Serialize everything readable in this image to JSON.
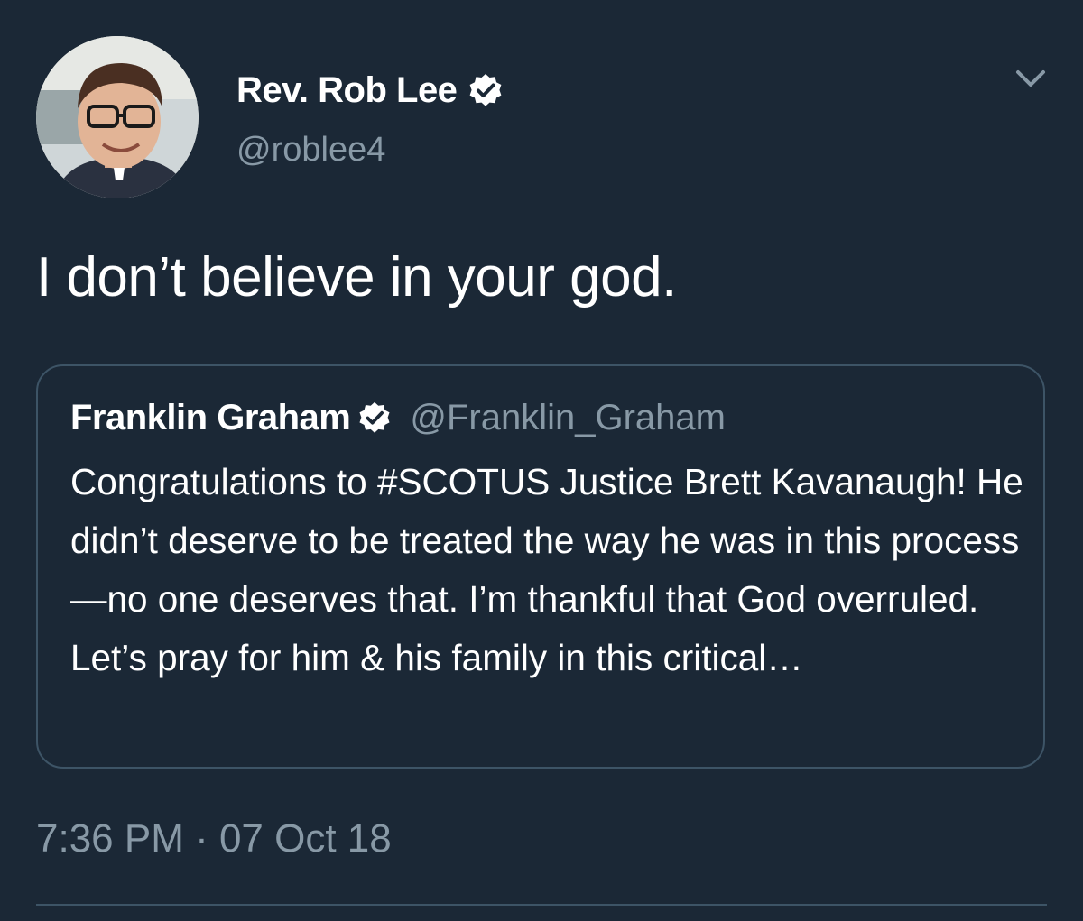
{
  "author": {
    "name": "Rev. Rob Lee",
    "handle": "@roblee4",
    "verified": true,
    "avatar_icon": "avatar-photo"
  },
  "tweet": {
    "text": "I don’t believe in your god.",
    "timestamp": "7:36 PM · 07 Oct 18"
  },
  "quoted_tweet": {
    "author_name": "Franklin Graham",
    "author_handle": "@Franklin_Graham",
    "verified": true,
    "text": "Congratulations to #SCOTUS Justice Brett Kavanaugh! He didn’t deserve to be treated the way he was in this process—no one deserves that. I’m thankful that God overruled. Let’s pray for him & his family in this critical…"
  },
  "icons": {
    "verified": "verified-badge-icon",
    "menu": "chevron-down-icon"
  },
  "colors": {
    "background": "#1b2836",
    "primary_text": "#ffffff",
    "secondary_text": "#8899a6",
    "border": "#3d5466"
  }
}
